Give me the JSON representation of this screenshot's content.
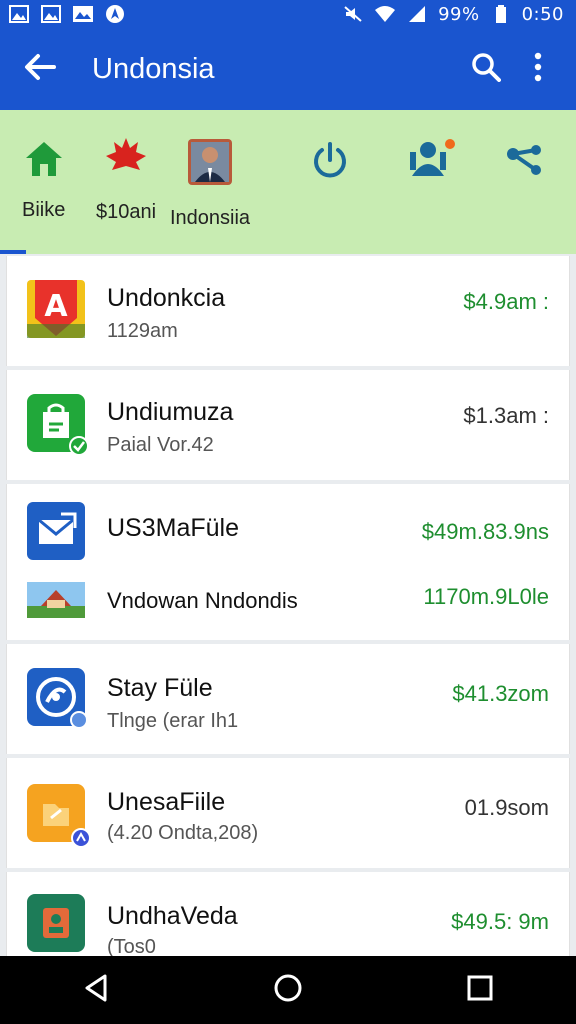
{
  "status_bar": {
    "battery": "99%",
    "time": "0:50",
    "icons": [
      "image-icon",
      "photo-icon",
      "photo-icon",
      "navigation-icon",
      "mute-icon",
      "wifi-icon",
      "signal-icon",
      "battery-icon"
    ]
  },
  "app_bar": {
    "title": "Undonsia",
    "back_icon": "arrow-back-icon",
    "search_icon": "search-icon",
    "more_icon": "more-vert-icon"
  },
  "tabs": [
    {
      "label": "Biike",
      "icon": "home-icon"
    },
    {
      "label": "$10ani",
      "icon": "maple-leaf-icon"
    },
    {
      "label": "Indonsiia",
      "icon": "profile-photo-icon"
    },
    {
      "label": "",
      "icon": "power-icon"
    },
    {
      "label": "",
      "icon": "group-icon"
    },
    {
      "label": "",
      "icon": "share-icon"
    }
  ],
  "list": [
    {
      "title": "Undonkcia",
      "subtitle": "1129am",
      "amount": "$4.9am :",
      "amount_color": "green",
      "icon_color": "#e8322b"
    },
    {
      "title": "Undiumuza",
      "subtitle": "Paial Vor.42",
      "amount": "$1.3am :",
      "amount_color": "gray",
      "icon_color": "#21a83a"
    },
    {
      "title": "US3MaFüle",
      "subtitle": "",
      "amount": "$49m.83.9ns",
      "amount_color": "green",
      "icon_color": "#1f5fc4",
      "sub_title": "Vndowan Nndondis",
      "sub_amount": "1170m.9L0le"
    },
    {
      "title": "Stay Füle",
      "subtitle": "Tlnge (erar Ih1",
      "amount": "$41.3zom",
      "amount_color": "green",
      "icon_color": "#1f5fc4"
    },
    {
      "title": "UnesaFiile",
      "subtitle": "(4.20 Ondta,208)",
      "amount": "01.9som",
      "amount_color": "gray",
      "icon_color": "#f5a320"
    },
    {
      "title": "UndhaVeda",
      "subtitle": "(Tos0",
      "amount": "$49.5: 9m",
      "amount_color": "green",
      "icon_color": "#1d7c58"
    }
  ],
  "nav_bar": {
    "back": "nav-back-icon",
    "home": "nav-home-icon",
    "recents": "nav-recents-icon"
  },
  "colors": {
    "primary": "#1a55cf",
    "tab_bg": "#c8ecb2",
    "green_text": "#1e8e2f"
  }
}
